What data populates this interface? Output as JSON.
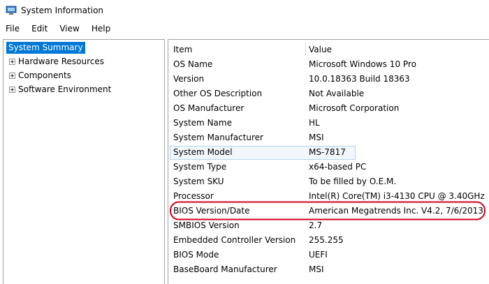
{
  "window": {
    "title": "System Information"
  },
  "menu": {
    "items": [
      "File",
      "Edit",
      "View",
      "Help"
    ]
  },
  "tree": {
    "root": "System Summary",
    "children": [
      "Hardware Resources",
      "Components",
      "Software Environment"
    ]
  },
  "table": {
    "headers": {
      "item": "Item",
      "value": "Value"
    },
    "rows": [
      {
        "item": "OS Name",
        "value": "Microsoft Windows 10 Pro"
      },
      {
        "item": "Version",
        "value": "10.0.18363 Build 18363"
      },
      {
        "item": "Other OS Description",
        "value": "Not Available"
      },
      {
        "item": "OS Manufacturer",
        "value": "Microsoft Corporation"
      },
      {
        "item": "System Name",
        "value": "HL"
      },
      {
        "item": "System Manufacturer",
        "value": "MSI"
      },
      {
        "item": "System Model",
        "value": "MS-7817"
      },
      {
        "item": "System Type",
        "value": "x64-based PC"
      },
      {
        "item": "System SKU",
        "value": "To be filled by O.E.M."
      },
      {
        "item": "Processor",
        "value": "Intel(R) Core(TM) i3-4130 CPU @ 3.40GHz"
      },
      {
        "item": "BIOS Version/Date",
        "value": "American Megatrends Inc. V4.2, 7/6/2013"
      },
      {
        "item": "SMBIOS Version",
        "value": "2.7"
      },
      {
        "item": "Embedded Controller Version",
        "value": "255.255"
      },
      {
        "item": "BIOS Mode",
        "value": "UEFI"
      },
      {
        "item": "BaseBoard Manufacturer",
        "value": "MSI"
      }
    ]
  },
  "colors": {
    "selection": "#0078d7",
    "annotation": "#d0021b",
    "border": "#a0a0a0"
  },
  "icons": {
    "app": "system-information-icon",
    "expander": "plus-box-icon"
  }
}
